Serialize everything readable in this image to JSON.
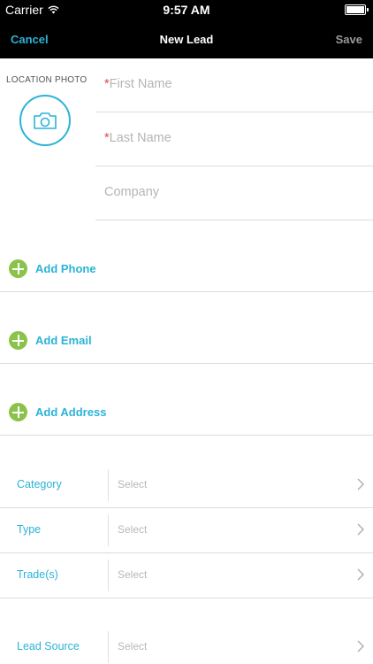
{
  "status_bar": {
    "carrier": "Carrier",
    "time": "9:57 AM",
    "icons": {
      "wifi": "wifi-icon",
      "battery": "battery-icon"
    }
  },
  "nav": {
    "cancel_label": "Cancel",
    "title": "New Lead",
    "save_label": "Save",
    "colors": {
      "accent": "#2bb3d7",
      "disabled": "#9a9a9a",
      "background": "#000000"
    }
  },
  "photo": {
    "label": "LOCATION PHOTO",
    "icon": "camera-icon"
  },
  "name_fields": [
    {
      "required_mark": "*",
      "placeholder": "First Name"
    },
    {
      "required_mark": "*",
      "placeholder": "Last Name"
    },
    {
      "required_mark": "",
      "placeholder": "Company"
    }
  ],
  "add_rows": [
    {
      "label": "Add Phone",
      "icon": "plus-circle-icon"
    },
    {
      "label": "Add Email",
      "icon": "plus-circle-icon"
    },
    {
      "label": "Add Address",
      "icon": "plus-circle-icon"
    }
  ],
  "select_rows": [
    {
      "label": "Category",
      "value": "Select"
    },
    {
      "label": "Type",
      "value": "Select"
    },
    {
      "label": "Trade(s)",
      "value": "Select"
    },
    {
      "label": "Lead Source",
      "value": "Select"
    }
  ],
  "colors": {
    "add_icon": "#8bc34a",
    "required": "#e2474f",
    "label": "#2bb3d7"
  }
}
